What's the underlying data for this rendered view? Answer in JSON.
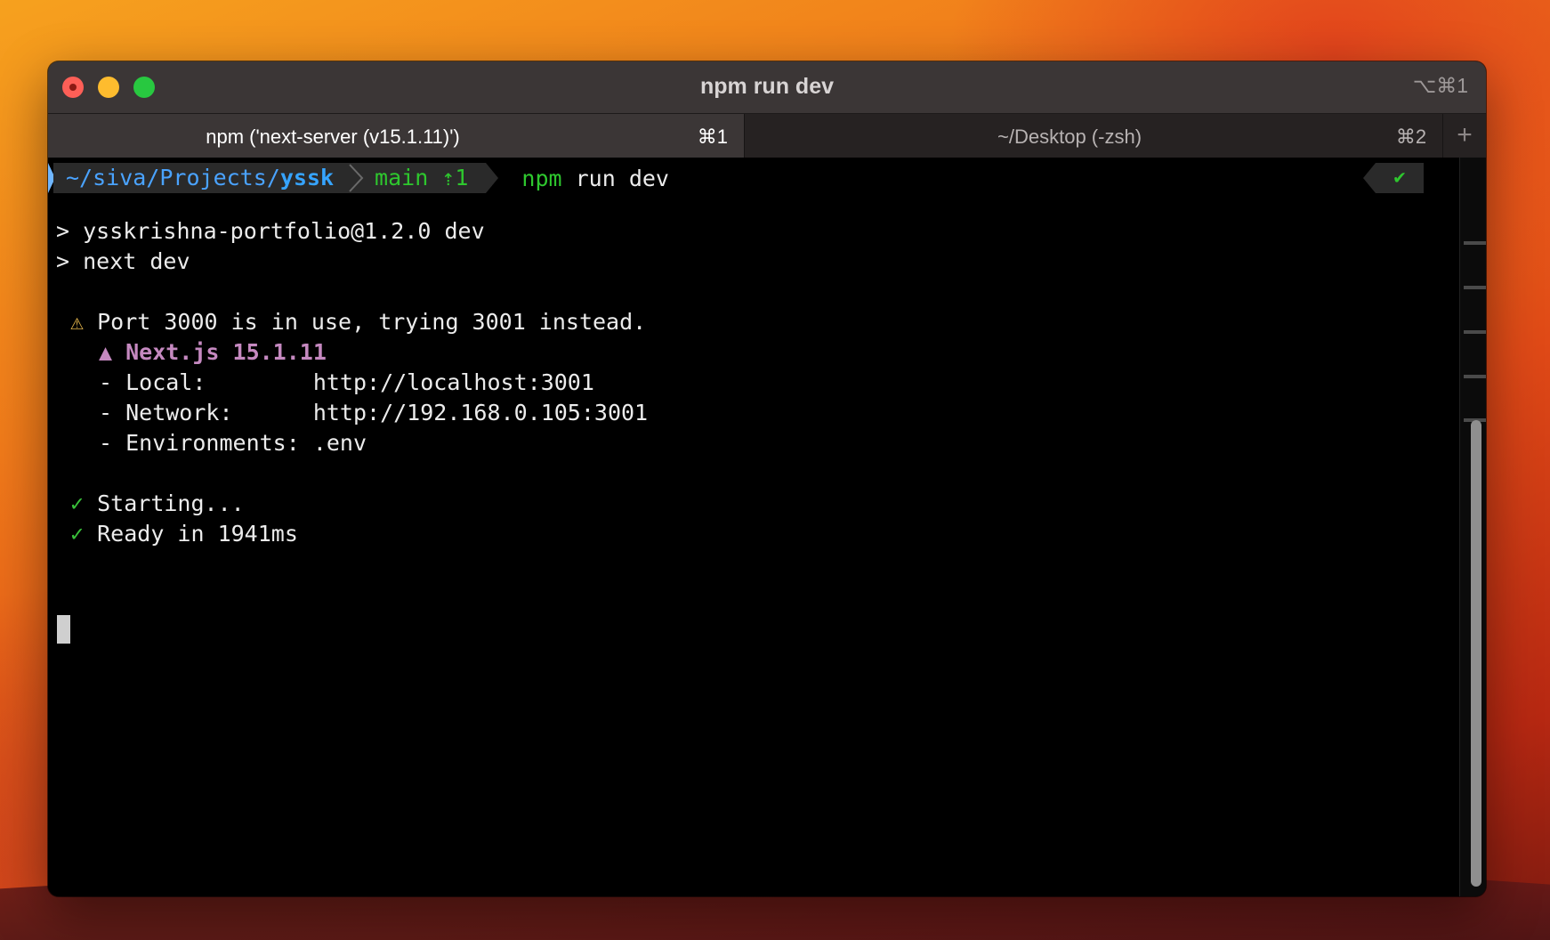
{
  "window": {
    "title": "npm run dev",
    "title_shortcut": "⌥⌘1"
  },
  "tabs": [
    {
      "label": "npm ('next-server (v15.1.11)')",
      "shortcut": "⌘1",
      "active": true
    },
    {
      "label": "~/Desktop (-zsh)",
      "shortcut": "⌘2",
      "active": false
    }
  ],
  "tab_add_label": "+",
  "prompt": {
    "path_prefix": "~/siva/Projects/",
    "path_dir": "yssk",
    "git": "main ⇡1",
    "command_bin": "npm",
    "command_args": " run dev",
    "status": "✔"
  },
  "output": {
    "line1": "> ysskrishna-portfolio@1.2.0 dev",
    "line2": "> next dev",
    "warn_icon": "⚠",
    "warn_text": " Port 3000 is in use, trying 3001 instead.",
    "next_banner": "▲ Next.js 15.1.11",
    "local": "- Local:        http://localhost:3001",
    "network": "- Network:      http://192.168.0.105:3001",
    "env": "- Environments: .env",
    "check_icon": "✓",
    "starting": " Starting...",
    "ready": " Ready in 1941ms"
  },
  "colors": {
    "path": "#36a4ff",
    "git": "#2ec72e",
    "warn": "#e0b24a",
    "nextjs": "#c589c0",
    "ok": "#39c13a"
  }
}
